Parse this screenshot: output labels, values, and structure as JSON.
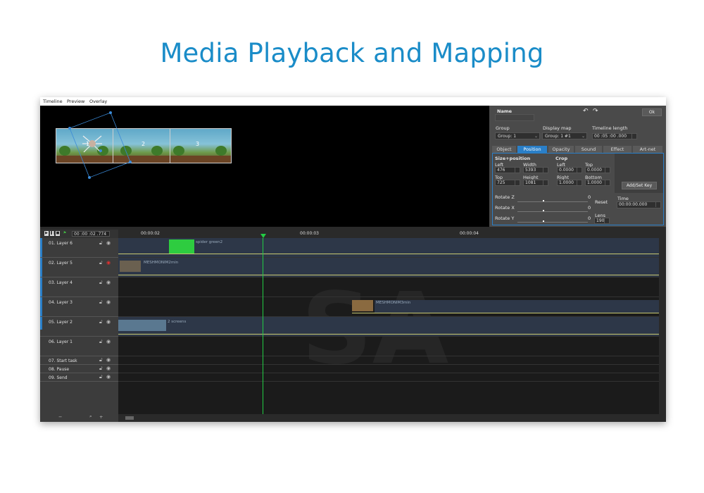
{
  "slide": {
    "title": "Media Playback and Mapping"
  },
  "menu": [
    "Timeline",
    "Preview",
    "Overlay"
  ],
  "preview": {
    "blocks": [
      "1",
      "2",
      "3"
    ]
  },
  "props": {
    "name_label": "Name",
    "ok_label": "Ok",
    "group_label": "Group",
    "group_value": "Group: 1",
    "display_map_label": "Display map",
    "display_map_value": "Group: 1 #1",
    "timeline_length_label": "Timeline length",
    "timeline_length_value": "00 :05 :00 .000",
    "tabs": [
      "Object",
      "Position",
      "Opacity",
      "Sound",
      "Effect",
      "Art-net"
    ],
    "active_tab": "Position",
    "size_position_label": "Size+position",
    "left_label": "Left",
    "left_value": "476",
    "width_label": "Width",
    "width_value": "5393",
    "top_label": "Top",
    "top_value": "725",
    "height_label": "Height",
    "height_value": "1081",
    "crop_label": "Crop",
    "crop_left_label": "Left",
    "crop_left_value": "0.0000",
    "crop_top_label": "Top",
    "crop_top_value": "0.0000",
    "crop_right_label": "Right",
    "crop_right_value": "1.0000",
    "crop_bottom_label": "Bottom",
    "crop_bottom_value": "1.0000",
    "add_key_label": "Add/Set Key",
    "rotate_z_label": "Rotate Z",
    "rotate_z_value": "0",
    "rotate_x_label": "Rotate X",
    "rotate_x_value": "0",
    "rotate_y_label": "Rotate Y",
    "rotate_y_value": "0",
    "reset_label": "Reset",
    "lens_label": "Lens",
    "lens_value": "190",
    "time_label": "Time",
    "time_value": "00:00:00.000"
  },
  "timeline": {
    "current_time": "00 :00 :02 .774",
    "ticks": [
      "00:00:02",
      "00:00:03",
      "00:00:04"
    ],
    "layers": [
      {
        "name": "01. Layer 6"
      },
      {
        "name": "02. Layer 5"
      },
      {
        "name": "03. Layer 4"
      },
      {
        "name": "04. Layer 3"
      },
      {
        "name": "05. Layer 2"
      },
      {
        "name": "06. Layer 1"
      },
      {
        "name": "07. Start task"
      },
      {
        "name": "08. Pause"
      },
      {
        "name": "09. Send"
      }
    ],
    "clips": {
      "spider": "spider green2",
      "layer5": "MESHMONIM2min",
      "layer3": "MESHMONIM3min",
      "layer2": "2 screens"
    },
    "watermark": "SA",
    "bottom_minus": "−",
    "bottom_plus": "+"
  },
  "colors": {
    "accent": "#2a7fc8",
    "title": "#1a8cc8",
    "playhead": "#22cc44",
    "clip_green": "#2ecc40"
  }
}
